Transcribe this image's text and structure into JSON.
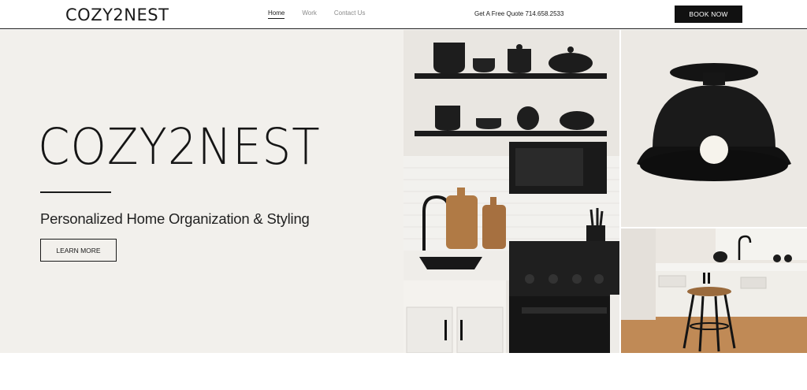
{
  "header": {
    "logo": "COZY2NEST",
    "nav": [
      {
        "label": "Home",
        "active": true
      },
      {
        "label": "Work",
        "active": false
      },
      {
        "label": "Contact Us",
        "active": false
      }
    ],
    "quote": "Get A Free Quote 714.658.2533",
    "cta": "BOOK NOW"
  },
  "hero": {
    "title": "COZY2NEST",
    "subtitle": "Personalized Home Organization & Styling",
    "button": "LEARN MORE"
  },
  "colors": {
    "hero_bg": "#f2f0ec",
    "accent": "#111111"
  }
}
